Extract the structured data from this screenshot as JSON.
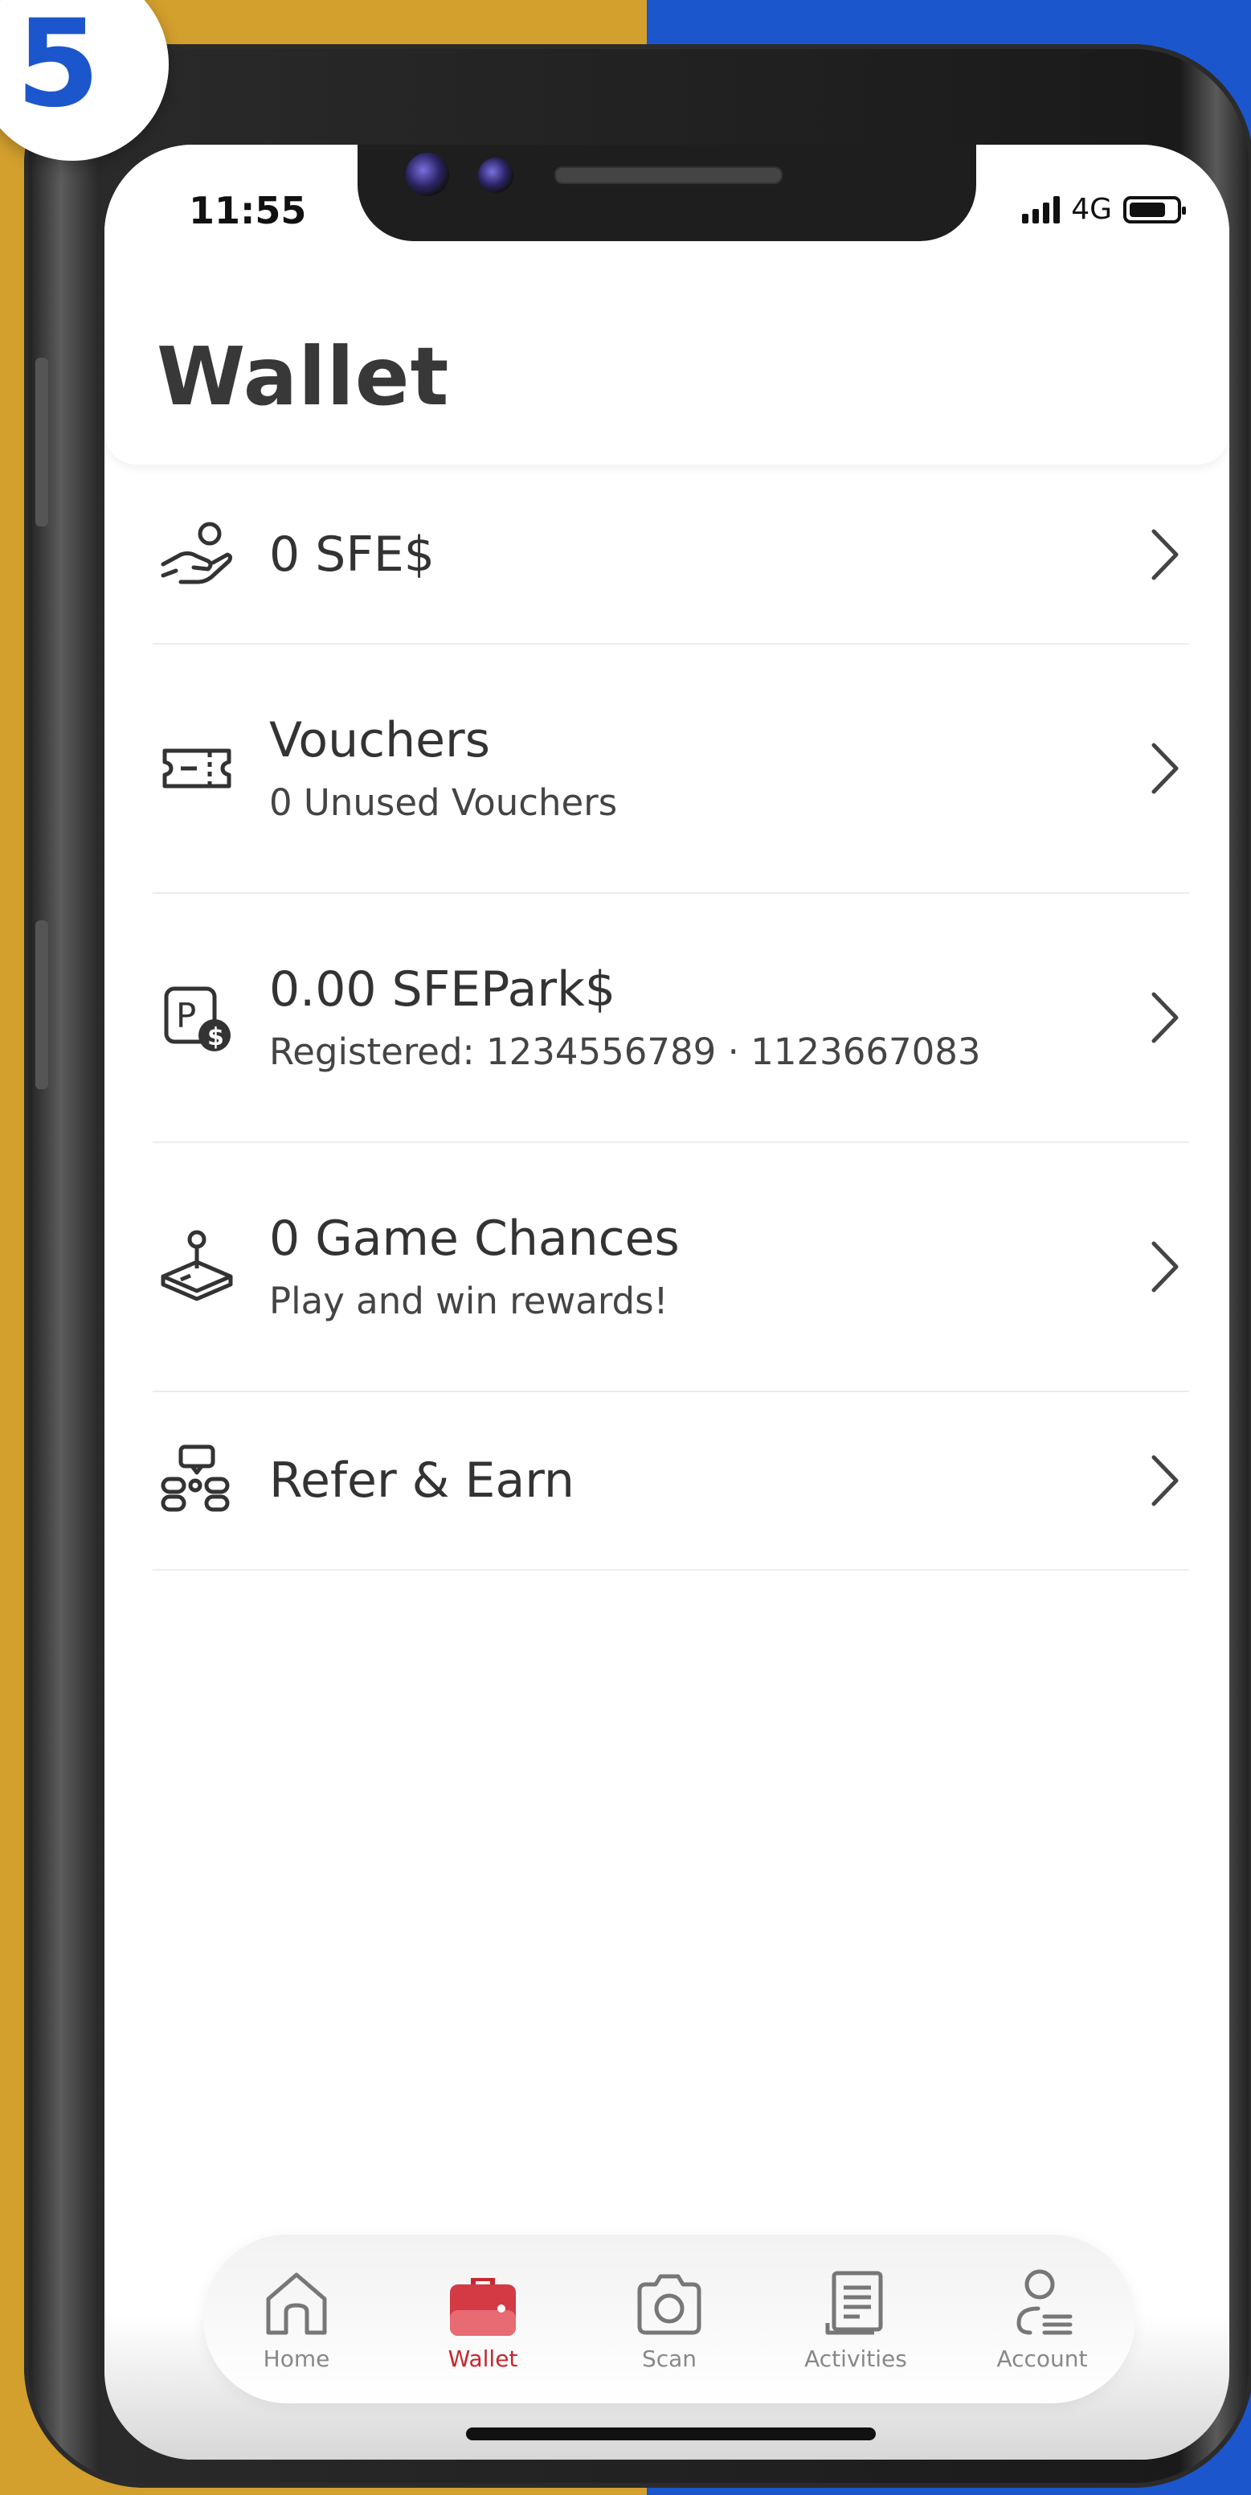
{
  "step": {
    "number": "5"
  },
  "status_bar": {
    "time": "11:55",
    "network": "4G",
    "battery_level": 0.75
  },
  "page": {
    "title": "Wallet"
  },
  "wallet_items": [
    {
      "title": "0 SFE$",
      "subtitle": "",
      "icon": "hand-coin-icon"
    },
    {
      "title": "Vouchers",
      "subtitle": "0 Unused Vouchers",
      "icon": "ticket-icon"
    },
    {
      "title": "0.00 SFEPark$",
      "subtitle": "Registered: 1234556789 · 1123667083",
      "icon": "parking-dollar-icon"
    },
    {
      "title": "0 Game Chances",
      "subtitle": "Play and win rewards!",
      "icon": "joystick-icon"
    },
    {
      "title": "Refer & Earn",
      "subtitle": "",
      "icon": "referral-icon"
    }
  ],
  "tabbar": {
    "active": "Wallet",
    "accent": "#c7262f",
    "tabs": [
      {
        "label": "Home",
        "icon": "home-icon"
      },
      {
        "label": "Wallet",
        "icon": "wallet-icon"
      },
      {
        "label": "Scan",
        "icon": "camera-icon"
      },
      {
        "label": "Activities",
        "icon": "document-icon"
      },
      {
        "label": "Account",
        "icon": "account-icon"
      }
    ]
  },
  "colors": {
    "background_left": "#d39f2d",
    "background_right": "#1c56cc",
    "title_text": "#383838"
  }
}
